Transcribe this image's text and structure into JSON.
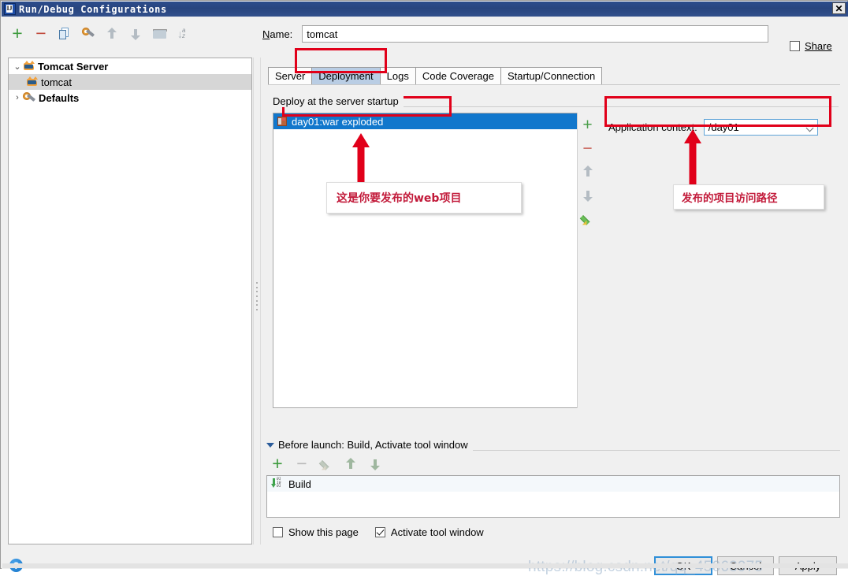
{
  "window": {
    "title": "Run/Debug Configurations",
    "close_label": "✕",
    "app_icon": "intellij-idea-icon"
  },
  "left_toolbar": {
    "buttons": [
      {
        "name": "add-configuration-button",
        "icon": "plus-icon",
        "label": "+"
      },
      {
        "name": "remove-configuration-button",
        "icon": "minus-icon",
        "label": "−"
      },
      {
        "name": "copy-configuration-button",
        "icon": "copy-icon",
        "label": ""
      },
      {
        "name": "edit-defaults-button",
        "icon": "wrench-icon",
        "label": ""
      },
      {
        "name": "move-up-button",
        "icon": "arrow-up-icon",
        "label": ""
      },
      {
        "name": "move-down-button",
        "icon": "arrow-down-icon",
        "label": ""
      },
      {
        "name": "new-folder-button",
        "icon": "folder-icon",
        "label": ""
      },
      {
        "name": "sort-alphabetically-button",
        "icon": "sort-az-icon",
        "label": ""
      }
    ]
  },
  "tree": {
    "items": [
      {
        "label": "Tomcat Server",
        "twisty": "⌄",
        "bold": true,
        "icon": "tomcat-icon",
        "indent": 0,
        "selected": false
      },
      {
        "label": "tomcat",
        "twisty": "",
        "bold": false,
        "icon": "tomcat-icon",
        "indent": 1,
        "selected": true
      },
      {
        "label": "Defaults",
        "twisty": "›",
        "bold": true,
        "icon": "wrench-icon",
        "indent": 0,
        "selected": false
      }
    ]
  },
  "name_field": {
    "label_prefix": "",
    "label_underlined": "N",
    "label_suffix": "ame:",
    "label_full": "Name:",
    "value": "tomcat"
  },
  "share": {
    "label": "Share",
    "checked": false
  },
  "tabs": [
    {
      "label": "Server",
      "active": false
    },
    {
      "label": "Deployment",
      "active": true
    },
    {
      "label": "Logs",
      "active": false
    },
    {
      "label": "Code Coverage",
      "active": false
    },
    {
      "label": "Startup/Connection",
      "active": false
    }
  ],
  "deployment": {
    "group_title": "Deploy at the server startup",
    "artifacts": [
      {
        "label": "day01:war exploded",
        "icon": "war-artifact-icon",
        "selected": true
      }
    ],
    "side_buttons": [
      {
        "name": "add-artifact-button",
        "icon": "plus-icon",
        "label": "+"
      },
      {
        "name": "remove-artifact-button",
        "icon": "minus-icon",
        "label": "−"
      },
      {
        "name": "artifact-move-up-button",
        "icon": "arrow-up-icon",
        "label": ""
      },
      {
        "name": "artifact-move-down-button",
        "icon": "arrow-down-icon",
        "label": ""
      },
      {
        "name": "edit-artifact-button",
        "icon": "pencil-icon",
        "label": ""
      }
    ],
    "application_context": {
      "label": "Application context:",
      "value": "/day01"
    }
  },
  "annotations": [
    {
      "name": "annotation-web-project",
      "text": "这是你要发布的web项目"
    },
    {
      "name": "annotation-access-path",
      "text": "发布的项目访问路径"
    }
  ],
  "before_launch": {
    "title": "Before launch: Build, Activate tool window",
    "toolbar": [
      {
        "name": "add-task-button",
        "icon": "plus-icon",
        "label": "+"
      },
      {
        "name": "remove-task-button",
        "icon": "minus-icon",
        "label": "−"
      },
      {
        "name": "edit-task-button",
        "icon": "pencil-icon",
        "label": ""
      },
      {
        "name": "task-move-up-button",
        "icon": "arrow-up-icon",
        "label": ""
      },
      {
        "name": "task-move-down-button",
        "icon": "arrow-down-icon",
        "label": ""
      }
    ],
    "tasks": [
      {
        "label": "Build",
        "icon": "build-icon"
      }
    ],
    "options": [
      {
        "name": "show-this-page-checkbox",
        "label": "Show this page",
        "checked": false
      },
      {
        "name": "activate-tool-window-checkbox",
        "label": "Activate tool window",
        "checked": true
      }
    ]
  },
  "footer": {
    "help_label": "?",
    "buttons": [
      {
        "name": "ok-button",
        "label": "OK",
        "default": true
      },
      {
        "name": "cancel-button",
        "label": "Cancel",
        "default": false
      },
      {
        "name": "apply-button",
        "label": "Apply",
        "default": false
      }
    ],
    "watermark": "https://blog.csdn.net/qq_45063975"
  },
  "colors": {
    "title_bar": "#2b4c8c",
    "selection_blue": "#1177cc",
    "active_tab": "#b9cde4",
    "annotation_red": "#e1001a",
    "annotation_text": "#c21a3a",
    "accent_green": "#3e9b3e"
  }
}
